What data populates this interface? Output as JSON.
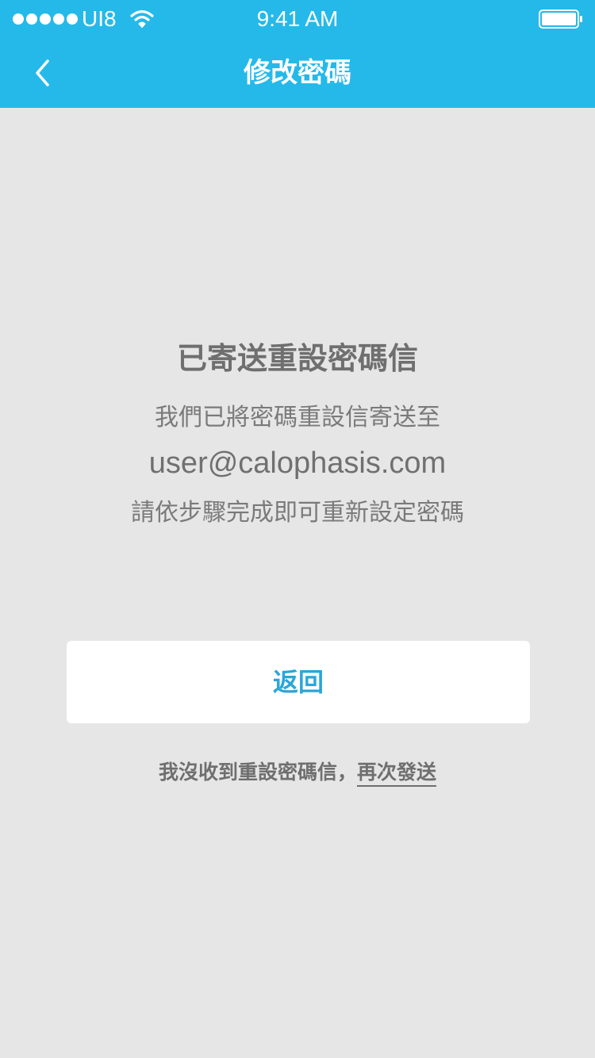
{
  "status_bar": {
    "carrier": "UI8",
    "time": "9:41 AM"
  },
  "nav": {
    "title": "修改密碼",
    "back_icon": "chevron-left-icon"
  },
  "main": {
    "heading": "已寄送重設密碼信",
    "line1": "我們已將密碼重設信寄送至",
    "email": "user@calophasis.com",
    "line3": "請依步驟完成即可重新設定密碼",
    "return_label": "返回",
    "resend_prefix": "我沒收到重設密碼信，",
    "resend_link": "再次發送"
  },
  "colors": {
    "accent": "#25b9ea",
    "background": "#e6e6e6",
    "button_text": "#2aa6d8",
    "text": "#6f6f6f"
  }
}
